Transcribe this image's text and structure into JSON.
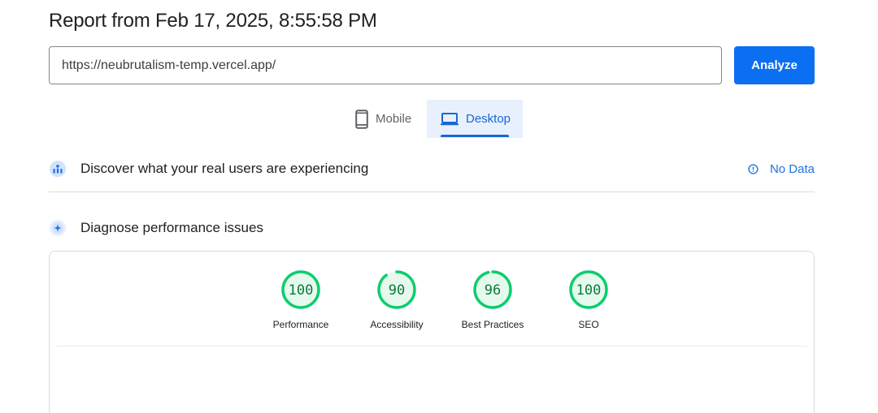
{
  "report": {
    "title": "Report from Feb 17, 2025, 8:55:58 PM"
  },
  "search": {
    "url_value": "https://neubrutalism-temp.vercel.app/",
    "analyze_label": "Analyze"
  },
  "tabs": [
    {
      "label": "Mobile",
      "icon": "smartphone-icon",
      "selected": false
    },
    {
      "label": "Desktop",
      "icon": "laptop-icon",
      "selected": true
    }
  ],
  "crux": {
    "title": "Discover what your real users are experiencing",
    "icon": "users-chart-icon",
    "no_data_label": "No Data",
    "no_data_icon": "info-icon"
  },
  "diagnose": {
    "title": "Diagnose performance issues",
    "icon": "lighthouse-icon"
  },
  "scores": [
    {
      "label": "Performance",
      "value": 100,
      "display": "100"
    },
    {
      "label": "Accessibility",
      "value": 90,
      "display": "90"
    },
    {
      "label": "Best Practices",
      "value": 96,
      "display": "96"
    },
    {
      "label": "SEO",
      "value": 100,
      "display": "100"
    }
  ],
  "colors": {
    "accent": "#1a73e8",
    "score_good": "#0cce6b",
    "score_good_fill": "#e6f9ee",
    "score_good_text": "#0c7a3a",
    "tab_selected_bg": "#e8f0fe"
  }
}
